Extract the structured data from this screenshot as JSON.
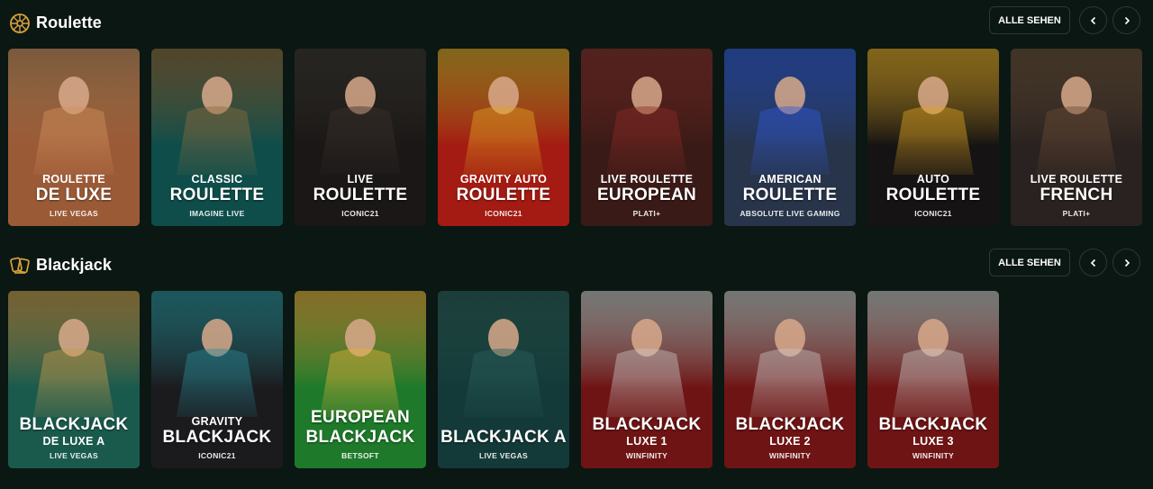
{
  "sections": [
    {
      "title": "Roulette",
      "see_all": "ALLE SEHEN",
      "icon": "roulette-wheel-icon",
      "games": [
        {
          "top": "ROULETTE",
          "sub": "DE LUXE",
          "provider": "LIVE VEGAS",
          "bg": "#9b5a36",
          "accent": "#d2905d"
        },
        {
          "top": "CLASSIC",
          "sub": "ROULETTE",
          "provider": "IMAGINE LIVE",
          "bg": "#0e4d4a",
          "accent": "#8a6a3d"
        },
        {
          "top": "LIVE",
          "sub": "ROULETTE",
          "provider": "ICONIC21",
          "bg": "#1a1716",
          "accent": "#3a302c"
        },
        {
          "top": "GRAVITY AUTO",
          "sub": "ROULETTE",
          "provider": "ICONIC21",
          "bg": "#a31b12",
          "accent": "#e0a321"
        },
        {
          "top": "LIVE ROULETTE",
          "sub": "EUROPEAN",
          "provider": "PLATI+",
          "bg": "#3a1a16",
          "accent": "#8b2a26"
        },
        {
          "top": "AMERICAN",
          "sub": "ROULETTE",
          "provider": "ABSOLUTE LIVE GAMING",
          "bg": "#273449",
          "accent": "#3159d6"
        },
        {
          "top": "AUTO",
          "sub": "ROULETTE",
          "provider": "ICONIC21",
          "bg": "#151313",
          "accent": "#e0a321"
        },
        {
          "top": "LIVE ROULETTE",
          "sub": "FRENCH",
          "provider": "PLATI+",
          "bg": "#2a2220",
          "accent": "#6b4c36"
        }
      ]
    },
    {
      "title": "Blackjack",
      "see_all": "ALLE SEHEN",
      "icon": "blackjack-cards-icon",
      "games": [
        {
          "top": "BLACKJACK",
          "sub": "DE LUXE A",
          "provider": "LIVE VEGAS",
          "bg": "#1a5a4d",
          "accent": "#c79c4c",
          "layout": "big-first"
        },
        {
          "top": "GRAVITY",
          "sub": "BLACKJACK",
          "provider": "ICONIC21",
          "bg": "#1b1b1e",
          "accent": "#2a8a96"
        },
        {
          "top": "EUROPEAN",
          "sub": "BLACKJACK",
          "provider": "BETSOFT",
          "bg": "#1e7a2a",
          "accent": "#e2b13a",
          "layout": "two-big"
        },
        {
          "top": "",
          "sub": "BLACKJACK A",
          "provider": "LIVE VEGAS",
          "bg": "#133a39",
          "accent": "#2a5d58"
        },
        {
          "top": "BLACKJACK",
          "sub": "LUXE 1",
          "provider": "WINFINITY",
          "bg": "#6e1414",
          "accent": "#c8c4c2",
          "layout": "big-first"
        },
        {
          "top": "BLACKJACK",
          "sub": "LUXE 2",
          "provider": "WINFINITY",
          "bg": "#6e1414",
          "accent": "#c8c4c2",
          "layout": "big-first"
        },
        {
          "top": "BLACKJACK",
          "sub": "LUXE 3",
          "provider": "WINFINITY",
          "bg": "#6e1414",
          "accent": "#c8c4c2",
          "layout": "big-first"
        }
      ]
    }
  ],
  "colors": {
    "background": "#0b1713",
    "brand_gold": "#d9a13a",
    "border": "#2c3833"
  }
}
